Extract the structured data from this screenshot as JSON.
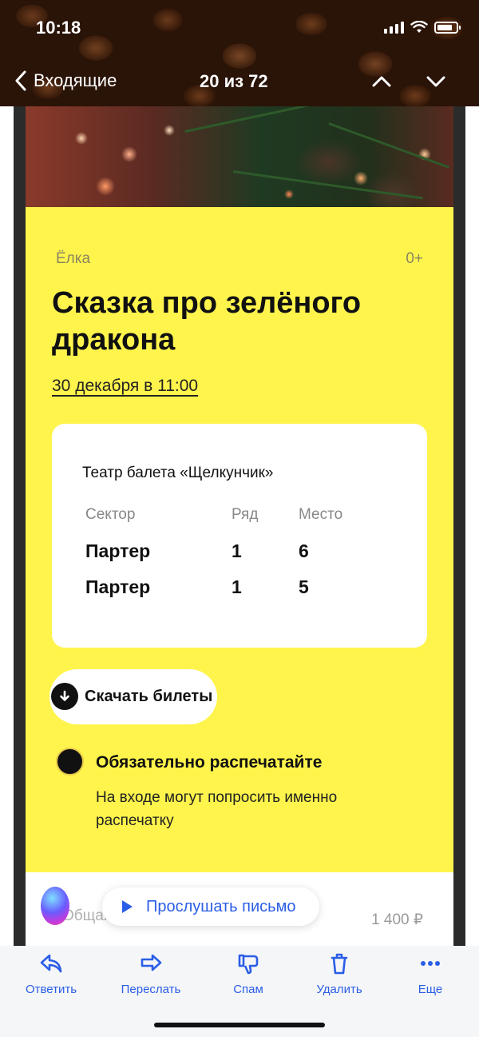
{
  "status_bar": {
    "time": "10:18"
  },
  "nav": {
    "back_label": "Входящие",
    "counter": "20 из 72"
  },
  "event": {
    "category": "Ёлка",
    "age_rating": "0+",
    "title": "Сказка про зелёного дракона",
    "date": "30 декабря в 11:00"
  },
  "ticket": {
    "venue": "Театр балета «Щелкунчик»",
    "headers": {
      "sector": "Сектор",
      "row": "Ряд",
      "seat": "Место"
    },
    "rows": [
      {
        "sector": "Партер",
        "row": "1",
        "seat": "6"
      },
      {
        "sector": "Партер",
        "row": "1",
        "seat": "5"
      }
    ]
  },
  "download": {
    "label": "Скачать билеты"
  },
  "notice": {
    "title": "Обязательно распечатайте",
    "text": "На входе могут попросить именно распечатку"
  },
  "lower": {
    "partial_label": "Общая",
    "price": "1 400 ₽"
  },
  "listen": {
    "label": "Прослушать письмо"
  },
  "toolbar": {
    "reply": "Ответить",
    "forward": "Переслать",
    "spam": "Спам",
    "delete": "Удалить",
    "more": "Еще"
  },
  "colors": {
    "accent": "#2b5ee6",
    "yellow": "#fef44c"
  }
}
